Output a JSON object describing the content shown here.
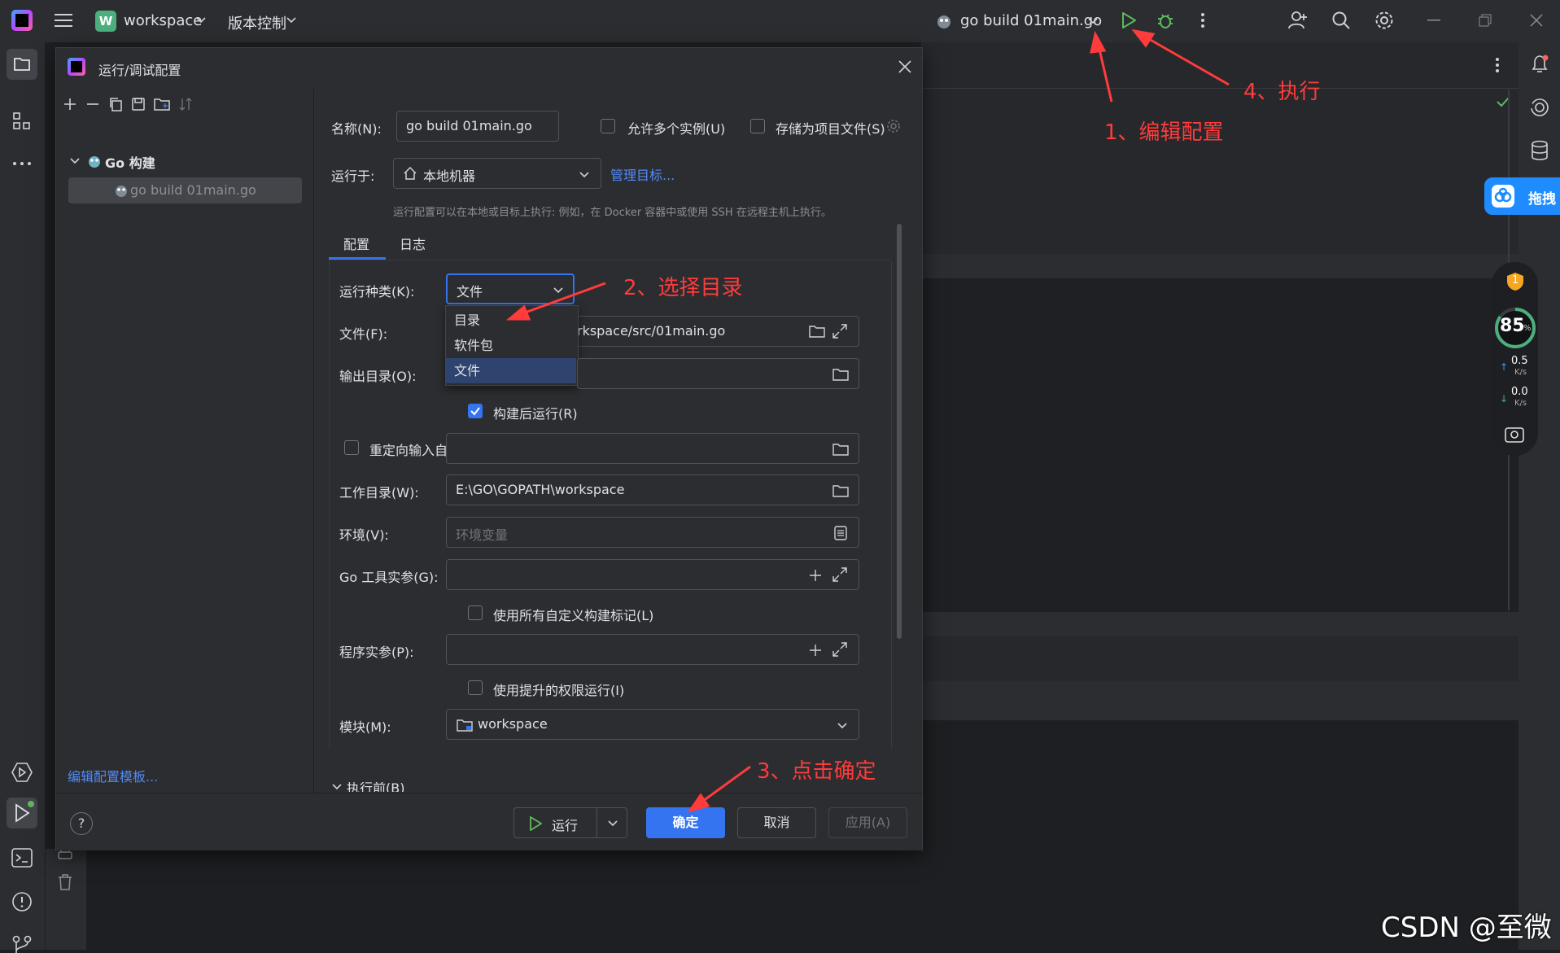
{
  "titlebar": {
    "project_badge": "W",
    "project_name": "workspace",
    "vcs_label": "版本控制",
    "run_config": "go build 01main.go"
  },
  "dialog": {
    "title": "运行/调试配置",
    "tree": {
      "group_label": "Go 构建",
      "item_label": "go build 01main.go"
    },
    "edit_templates_link": "编辑配置模板...",
    "name_label": "名称(N):",
    "name_value": "go build 01main.go",
    "allow_parallel_label": "允许多个实例(U)",
    "store_as_project_label": "存储为项目文件(S)",
    "run_on_label": "运行于:",
    "run_on_value": "本地机器",
    "manage_targets_link": "管理目标...",
    "run_on_hint": "运行配置可以在本地或目标上执行: 例如，在 Docker 容器中或使用 SSH 在远程主机上执行。",
    "tabs": [
      "配置",
      "日志"
    ],
    "run_kind_label": "运行种类(K):",
    "run_kind_value": "文件",
    "run_kind_options": [
      "目录",
      "软件包",
      "文件"
    ],
    "file_label": "文件(F):",
    "file_value": "rkspace/src/01main.go",
    "output_dir_label": "输出目录(O):",
    "output_dir_value": "",
    "run_after_build_label": "构建后运行(R)",
    "redirect_input_label": "重定向输入自:",
    "working_dir_label": "工作目录(W):",
    "working_dir_value": "E:\\GO\\GOPATH\\workspace",
    "env_label": "环境(V):",
    "env_placeholder": "环境变量",
    "go_tool_args_label": "Go 工具实参(G):",
    "use_custom_tags_label": "使用所有自定义构建标记(L)",
    "program_args_label": "程序实参(P):",
    "elevated_label": "使用提升的权限运行(I)",
    "module_label": "模块(M):",
    "module_value": "workspace",
    "before_launch_label": "执行前(B)",
    "buttons": {
      "run": "运行",
      "ok": "确定",
      "cancel": "取消",
      "apply": "应用(A)"
    },
    "help": "?"
  },
  "annotations": {
    "step1": "1、编辑配置",
    "step2": "2、选择目录",
    "step3": "3、点击确定",
    "step4": "4、执行"
  },
  "widget": {
    "score": "85",
    "score_unit": "%",
    "upload_value": "0.5",
    "upload_unit": "K/s",
    "download_value": "0.0",
    "download_unit": "K/s",
    "shield_badge": "1",
    "baidu_label": "拖拽"
  },
  "watermark": "CSDN @至微",
  "colors": {
    "accent": "#3574f0",
    "annotation": "#ff3b3b",
    "run_green": "#5fb85f"
  }
}
